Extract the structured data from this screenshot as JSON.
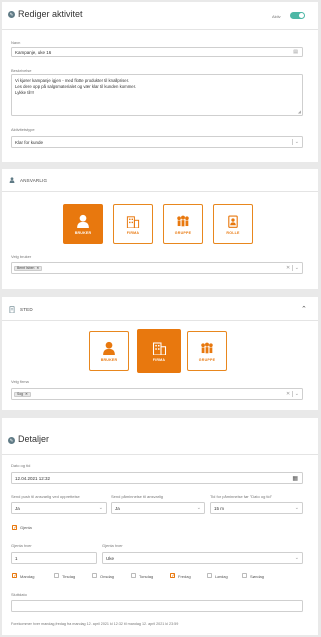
{
  "header": {
    "title": "Rediger aktivitet",
    "active_label": "Aktiv"
  },
  "general": {
    "name_label": "Navn",
    "name_value": "Kampanje, uke 16",
    "desc_label": "Beskrivelse",
    "desc_lines": [
      "Vi kjører kampanje igjen - med flotte produkter til knallpriser.",
      "Les dere opp på salgsmaterialet og vær klar til kunden kommer.",
      "Lykke til!!!"
    ],
    "status_label": "Aktivitetstype",
    "status_value": "Klar for kunde"
  },
  "responsible": {
    "title": "ANSVARLIG",
    "tiles": [
      {
        "label": "BRUKER",
        "icon": "user-icon",
        "active": true
      },
      {
        "label": "FIRMA",
        "icon": "building-icon",
        "active": false
      },
      {
        "label": "GRUPPE",
        "icon": "group-icon",
        "active": false
      },
      {
        "label": "ROLLE",
        "icon": "role-icon",
        "active": false
      }
    ],
    "select_label": "Velg bruker",
    "chip": "Bernt Isben"
  },
  "place": {
    "title": "STED",
    "tiles": [
      {
        "label": "BRUKER",
        "icon": "user-icon",
        "active": false
      },
      {
        "label": "FIRMA",
        "icon": "building-icon",
        "active": true
      },
      {
        "label": "GRUPPE",
        "icon": "group-icon",
        "active": false
      }
    ],
    "select_label": "Velg firma",
    "chip": "Sog"
  },
  "details": {
    "title": "Detaljer",
    "date_label": "Dato og tid",
    "date_value": "12.04.2021 12:32",
    "push_label": "Send push til ansvarlig ved opprettelse",
    "push_value": "Ja",
    "reminder_label": "Send påminnelse til ansvarlig",
    "reminder_value": "Ja",
    "time_label": "Tid for påminnelse før \"Dato og tid\"",
    "time_value": "15 m",
    "repeat_label": "Gjenta",
    "every_label": "Gjenta hver",
    "every_value": "1",
    "unit_label": "Gjenta hver",
    "unit_value": "Uke",
    "days": [
      {
        "label": "Mandag",
        "checked": true
      },
      {
        "label": "Tirsdag",
        "checked": false
      },
      {
        "label": "Onsdag",
        "checked": false
      },
      {
        "label": "Torsdag",
        "checked": false
      },
      {
        "label": "Fredag",
        "checked": true
      },
      {
        "label": "Lørdag",
        "checked": false
      },
      {
        "label": "Søndag",
        "checked": false
      }
    ],
    "end_label": "Sluttdato",
    "footer_text": "Forekommer hver mandag,fredag fra mandag 12. april 2021 kl 12:32 til mandag 12. april 2021 kl 23:59"
  },
  "colors": {
    "accent": "#e8780e",
    "toggle": "#4cb7a5",
    "icon_bg": "#607b86"
  }
}
